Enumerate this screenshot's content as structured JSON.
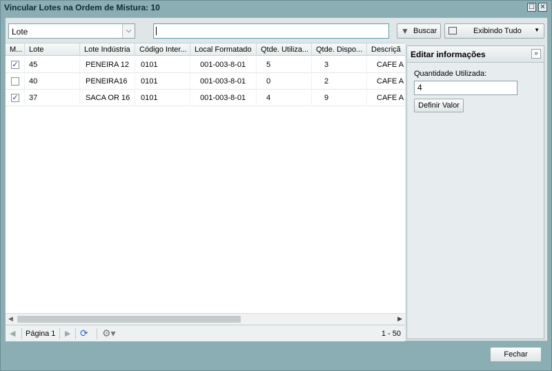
{
  "window": {
    "title": "Vincular Lotes na Ordem de Mistura: 10",
    "restore_icon": "☐",
    "close_icon": "✕"
  },
  "toolbar": {
    "filter_field": "Lote",
    "search_value": "",
    "buscar_label": "Buscar",
    "exibindo_label": "Exibindo Tudo"
  },
  "grid": {
    "columns": [
      "M...",
      "Lote",
      "Lote Indústria",
      "Código Inter...",
      "Local Formatado",
      "Qtde. Utiliza...",
      "Qtde. Dispo...",
      "Descriçã"
    ],
    "rows": [
      {
        "checked": "✓",
        "lote": "45",
        "lote_industria": "PENEIRA 12",
        "codigo": "0101",
        "local": "001-003-8-01",
        "qtde_utilizada": "5",
        "qtde_disponivel": "3",
        "descricao": "CAFE A"
      },
      {
        "checked": "",
        "lote": "40",
        "lote_industria": "PENEIRA16",
        "codigo": "0101",
        "local": "001-003-8-01",
        "qtde_utilizada": "0",
        "qtde_disponivel": "2",
        "descricao": "CAFE A"
      },
      {
        "checked": "✓",
        "lote": "37",
        "lote_industria": "SACA OR 16",
        "codigo": "0101",
        "local": "001-003-8-01",
        "qtde_utilizada": "4",
        "qtde_disponivel": "9",
        "descricao": "CAFE A"
      }
    ]
  },
  "pager": {
    "page_label": "Página 1",
    "count": "1 - 50"
  },
  "panel": {
    "title": "Editar informações",
    "field_label": "Quantidade Utilizada:",
    "field_value": "4",
    "button_label": "Definir Valor"
  },
  "footer": {
    "close_label": "Fechar"
  }
}
